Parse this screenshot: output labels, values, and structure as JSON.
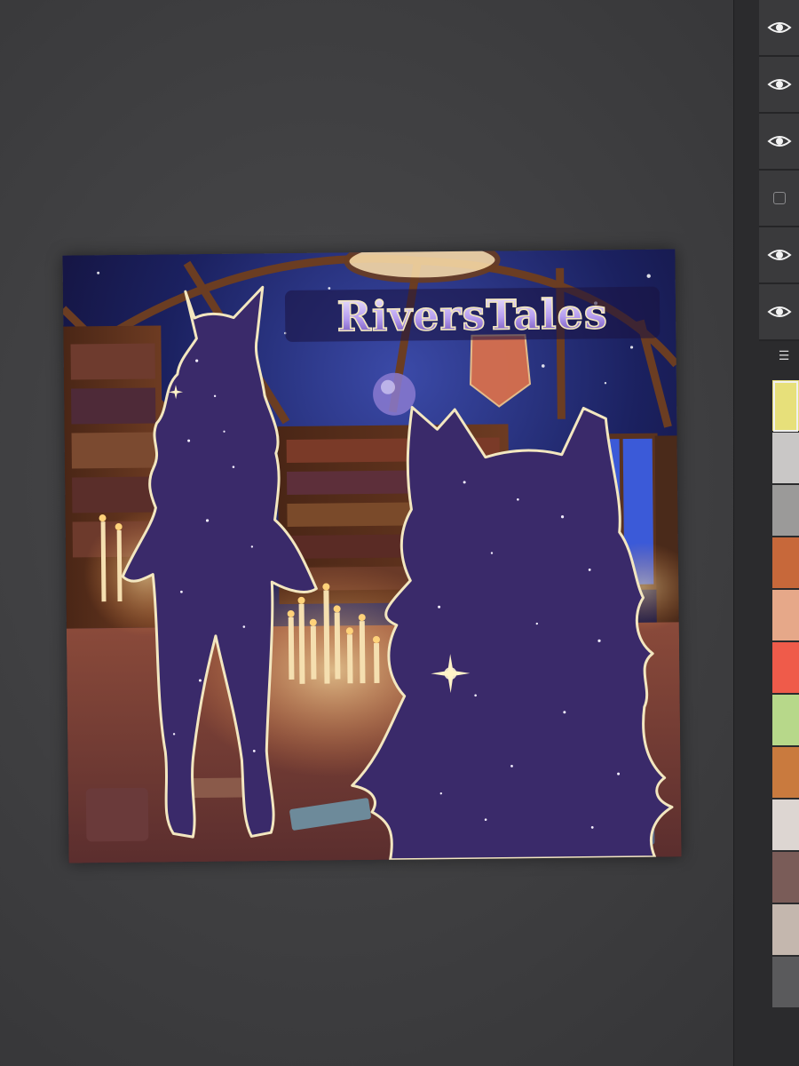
{
  "artwork": {
    "title_text": "RiversTales"
  },
  "layers_panel": {
    "rows": [
      {
        "name": "layer-1",
        "visible": true
      },
      {
        "name": "layer-2",
        "visible": true
      },
      {
        "name": "layer-3",
        "visible": true
      },
      {
        "name": "layer-4",
        "visible": false
      },
      {
        "name": "layer-5",
        "visible": true
      },
      {
        "name": "layer-6",
        "visible": true
      }
    ],
    "menu_icon": "☰"
  },
  "palette": {
    "swatches": [
      "#e7e07a",
      "#c9c7c6",
      "#9b9a99",
      "#c7683a",
      "#e6a889",
      "#ef5b4a",
      "#b7d88a",
      "#c97a3e",
      "#ddd6d2",
      "#7a5c58",
      "#c4b7ae",
      "#5a5a5c"
    ],
    "selected_index": 0
  },
  "colors": {
    "silhouette": "#3b2a6b",
    "outline": "#f3e7c0",
    "sky": "#1b2160",
    "wood": "#5a3320",
    "candle_glow": "#ffcf7a"
  }
}
